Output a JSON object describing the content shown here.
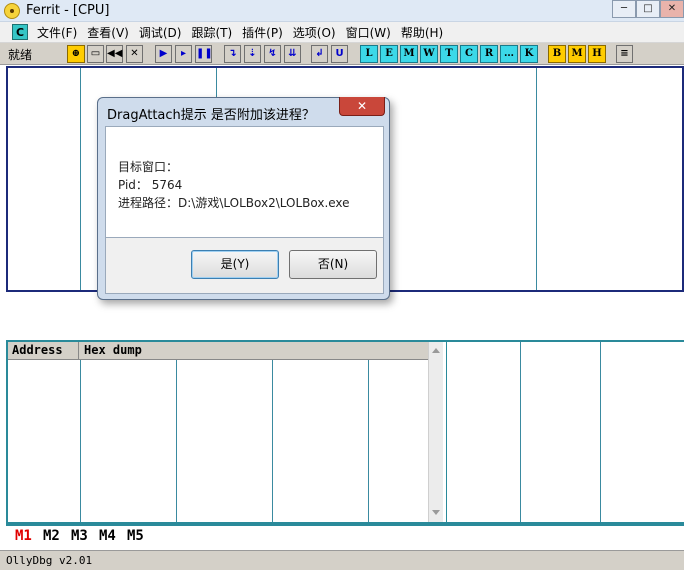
{
  "window": {
    "title": "Ferrit - [CPU]",
    "controls": {
      "minimize": "─",
      "maximize": "□",
      "close": "✕"
    }
  },
  "menubar": {
    "badge": "C",
    "items": [
      "文件(F)",
      "查看(V)",
      "调试(D)",
      "跟踪(T)",
      "插件(P)",
      "选项(O)",
      "窗口(W)",
      "帮助(H)"
    ]
  },
  "toolbar": {
    "status": "就绪",
    "buttons": [
      {
        "label": "⊕",
        "icon": "crosshair-icon"
      },
      {
        "label": "▭",
        "icon": "open-folder-icon"
      },
      {
        "label": "◀◀",
        "icon": "rewind-icon"
      },
      {
        "label": "✕",
        "icon": "close-process-icon"
      },
      {
        "label": "▶",
        "icon": "run-icon"
      },
      {
        "label": "▸",
        "icon": "run-thread-icon"
      },
      {
        "label": "❚❚",
        "icon": "pause-icon"
      },
      {
        "label": "↴",
        "icon": "step-into-icon"
      },
      {
        "label": "⇣",
        "icon": "step-over-icon"
      },
      {
        "label": "↯",
        "icon": "trace-into-icon"
      },
      {
        "label": "⇊",
        "icon": "trace-over-icon"
      },
      {
        "label": "↲",
        "icon": "execute-till-return-icon"
      },
      {
        "label": "U",
        "icon": "execute-till-user-code-icon"
      }
    ],
    "window_buttons": [
      "L",
      "E",
      "M",
      "W",
      "T",
      "C",
      "R",
      "…",
      "K"
    ],
    "extra_buttons": [
      "B",
      "M",
      "H"
    ],
    "list_icon": "≡"
  },
  "dump": {
    "columns": [
      "Address",
      "Hex dump"
    ]
  },
  "memory_tabs": [
    {
      "label": "M1",
      "color": "#e00000"
    },
    {
      "label": "M2",
      "color": "#000000"
    },
    {
      "label": "M3",
      "color": "#000000"
    },
    {
      "label": "M4",
      "color": "#000000"
    },
    {
      "label": "M5",
      "color": "#000000"
    }
  ],
  "statusbar": {
    "version": "OllyDbg v2.01"
  },
  "dialog": {
    "title": "DragAttach提示 是否附加该进程？",
    "close_label": "✕",
    "lines": [
      "目标窗口：",
      "Pid：  5764",
      "进程路径：D:\\游戏\\LOLBox2\\LOLBox.exe"
    ],
    "yes_label": "是(Y)",
    "no_label": "否(N)"
  }
}
